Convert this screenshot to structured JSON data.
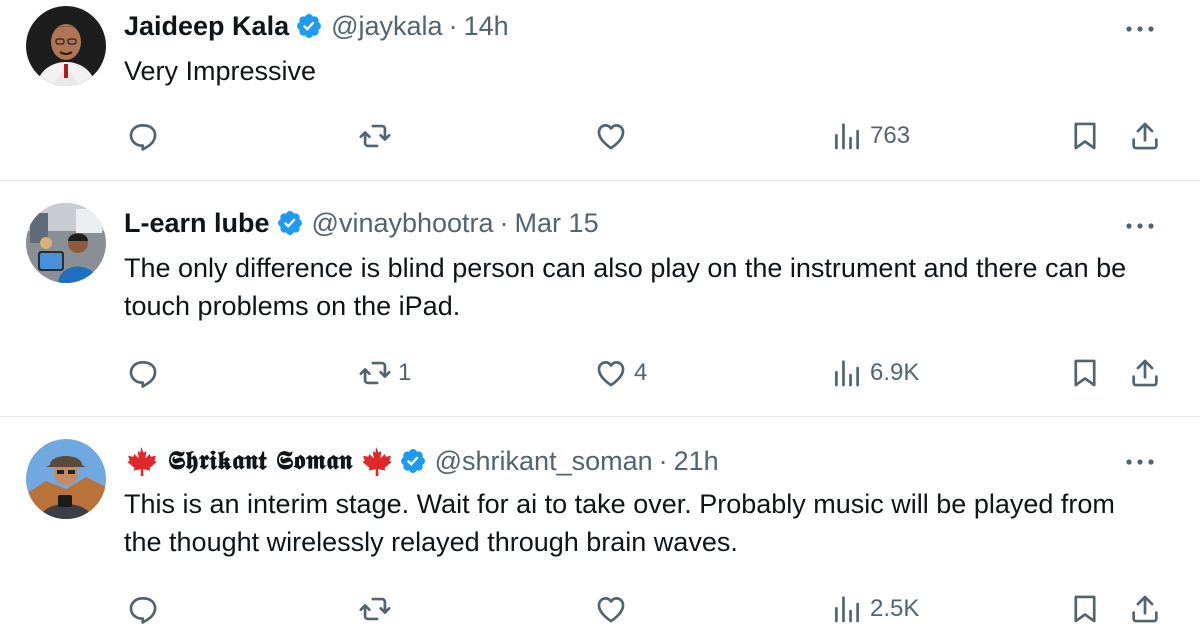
{
  "tweets": [
    {
      "name": "Jaideep Kala",
      "handle": "@jaykala",
      "separator": "·",
      "time": "14h",
      "text": "Very Impressive",
      "reply_count": "",
      "retweet_count": "",
      "like_count": "",
      "views": "763"
    },
    {
      "name": "L-earn lube",
      "handle": "@vinaybhootra",
      "separator": "·",
      "time": "Mar 15",
      "text": "The only difference is blind person can also play on the instrument and there can be touch problems on the iPad.",
      "reply_count": "",
      "retweet_count": "1",
      "like_count": "4",
      "views": "6.9K"
    },
    {
      "name": "𝕾𝖍𝖗𝖎𝖐𝖆𝖓𝖙 𝕾𝖔𝖒𝖆𝖓",
      "handle": "@shrikant_soman",
      "separator": "·",
      "time": "21h",
      "text": "This is an interim stage. Wait for ai to take over. Probably music will be played from the thought wirelessly relayed through brain waves.",
      "reply_count": "",
      "retweet_count": "",
      "like_count": "",
      "views": "2.5K"
    }
  ],
  "icons": {
    "verified": "verified-badge-icon",
    "more": "more-dots-icon",
    "reply": "reply-icon",
    "retweet": "retweet-icon",
    "like": "heart-icon",
    "views": "views-chart-icon",
    "bookmark": "bookmark-icon",
    "share": "share-icon",
    "maple_leaf": "maple-leaf-icon"
  },
  "colors": {
    "text": "#0f1419",
    "secondary": "#536471",
    "verified": "#1d9bf0",
    "divider": "#e6eaed",
    "maple_leaf": "#e0272a"
  }
}
